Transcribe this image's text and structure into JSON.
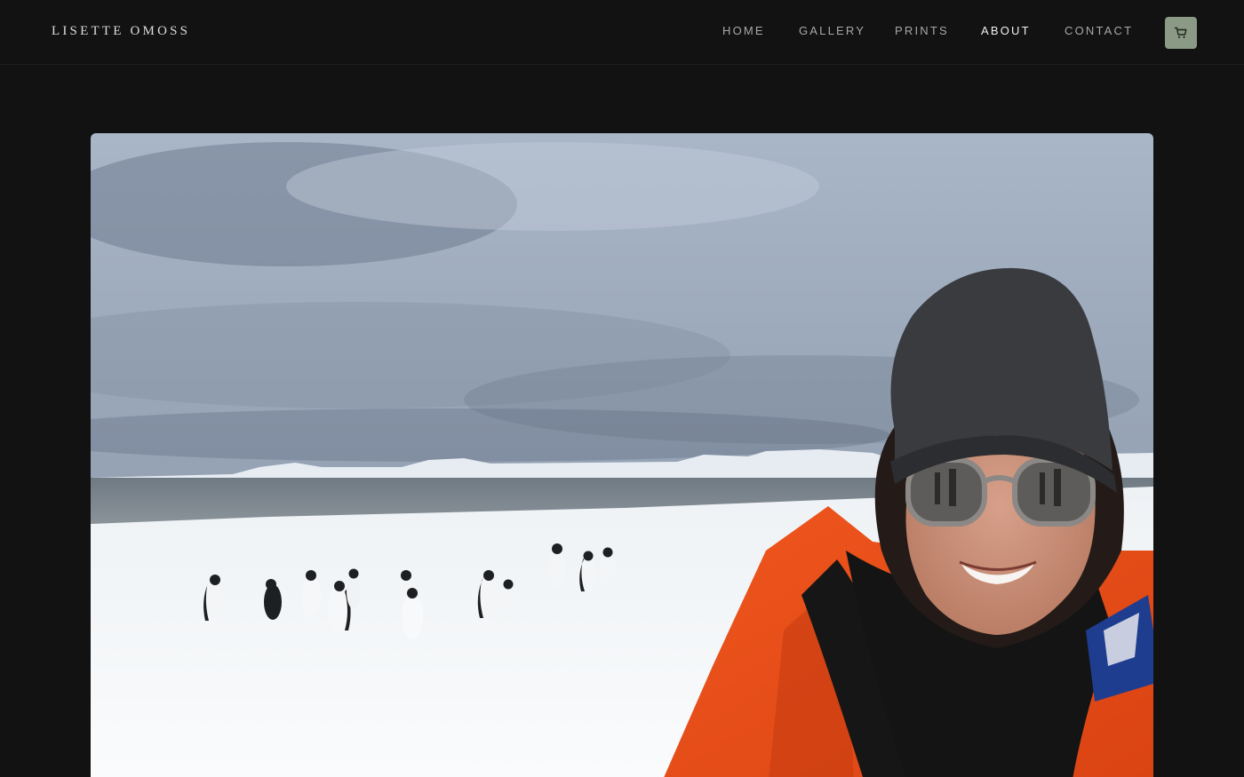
{
  "header": {
    "brand": "LISETTE OMOSS",
    "nav": [
      {
        "label": "HOME",
        "active": false
      },
      {
        "label": "GALLERY",
        "active": false
      },
      {
        "label": "PRINTS",
        "active": false
      },
      {
        "label": "ABOUT",
        "active": true
      },
      {
        "label": "CONTACT",
        "active": false
      }
    ],
    "cart_icon": "shopping-cart-icon"
  },
  "main": {
    "photo_subject": "portrait photo"
  },
  "colors": {
    "background": "#121212",
    "accent": "#8a9a84",
    "nav_text": "#a8a8a8",
    "nav_active": "#f0f0f0"
  }
}
